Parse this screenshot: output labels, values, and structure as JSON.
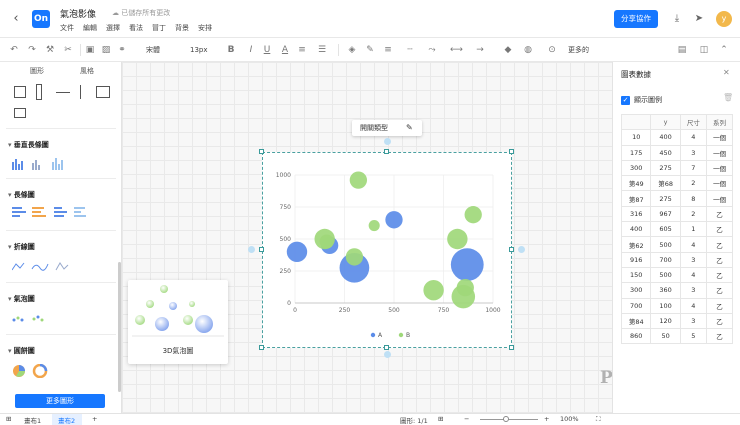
{
  "app": {
    "logo_text": "On",
    "doc_title": "氣泡影像",
    "save_status": "已儲存所有更改",
    "menu": [
      "文件",
      "編輯",
      "選擇",
      "看法",
      "冒丁",
      "背景",
      "安排"
    ],
    "share_label": "分享協作",
    "avatar_letter": "y"
  },
  "toolbar": {
    "font_name": "宋體",
    "font_size": "13px",
    "more_label": "更多的"
  },
  "sidebar": {
    "tabs": [
      "圖形",
      "風格"
    ],
    "sections": [
      "垂直長條圖",
      "長條圖",
      "折線圖",
      "氣泡圖",
      "圓餅圖"
    ],
    "more_button": "更多圖形",
    "hover_label": "3D氣泡圖"
  },
  "canvas": {
    "float_label": "開關類型"
  },
  "chart_data": {
    "type": "scatter",
    "xlim": [
      0,
      1000
    ],
    "ylim": [
      0,
      1000
    ],
    "x_ticks": [
      "0",
      "250",
      "500",
      "750",
      "1000"
    ],
    "y_ticks": [
      "0",
      "250",
      "500",
      "750",
      "1000"
    ],
    "legend": [
      "A",
      "B"
    ],
    "colors": {
      "A": "#5b8ce8",
      "B": "#9fd87a"
    },
    "series": [
      {
        "name": "A",
        "points": [
          {
            "x": 10,
            "y": 400,
            "size": 4
          },
          {
            "x": 175,
            "y": 450,
            "size": 3
          },
          {
            "x": 300,
            "y": 275,
            "size": 7
          },
          {
            "x": 500,
            "y": 650,
            "size": 3
          },
          {
            "x": 870,
            "y": 300,
            "size": 8
          }
        ]
      },
      {
        "name": "B",
        "points": [
          {
            "x": 150,
            "y": 500,
            "size": 4
          },
          {
            "x": 320,
            "y": 960,
            "size": 3
          },
          {
            "x": 400,
            "y": 605,
            "size": 1
          },
          {
            "x": 160,
            "y": 480,
            "size": 2
          },
          {
            "x": 700,
            "y": 100,
            "size": 4
          },
          {
            "x": 850,
            "y": 50,
            "size": 5
          },
          {
            "x": 860,
            "y": 120,
            "size": 3
          },
          {
            "x": 900,
            "y": 690,
            "size": 3
          },
          {
            "x": 820,
            "y": 500,
            "size": 4
          },
          {
            "x": 300,
            "y": 360,
            "size": 3
          }
        ]
      }
    ]
  },
  "panel": {
    "title": "圖表數據",
    "legend_toggle": "顯示圖例",
    "columns": [
      "",
      "y",
      "尺寸",
      "系列"
    ],
    "rows": [
      [
        "10",
        "400",
        "4",
        "一個"
      ],
      [
        "175",
        "450",
        "3",
        "一個"
      ],
      [
        "300",
        "275",
        "7",
        "一個"
      ],
      [
        "第49",
        "第68",
        "2",
        "一個"
      ],
      [
        "第87",
        "275",
        "8",
        "一個"
      ],
      [
        "316",
        "967",
        "2",
        "乙"
      ],
      [
        "400",
        "605",
        "1",
        "乙"
      ],
      [
        "第62",
        "500",
        "4",
        "乙"
      ],
      [
        "916",
        "700",
        "3",
        "乙"
      ],
      [
        "150",
        "500",
        "4",
        "乙"
      ],
      [
        "300",
        "360",
        "3",
        "乙"
      ],
      [
        "700",
        "100",
        "4",
        "乙"
      ],
      [
        "第84",
        "120",
        "3",
        "乙"
      ],
      [
        "860",
        "50",
        "5",
        "乙"
      ]
    ]
  },
  "statusbar": {
    "page_tabs": [
      "畫布1",
      "畫布2"
    ],
    "shape_count": "圖形: 1/1",
    "zoom": "100%"
  },
  "watermark": "ProcessOn"
}
